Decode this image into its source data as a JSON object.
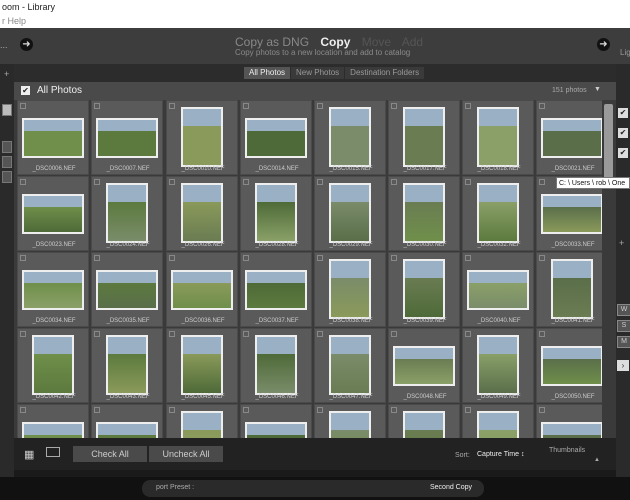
{
  "window": {
    "title": "oom - Library",
    "menu": "r Help"
  },
  "modebar": {
    "copy_dng": "Copy as DNG",
    "copy": "Copy",
    "move": "Move",
    "add": "Add",
    "subtitle": "Copy photos to a new location and add to catalog",
    "ellipsis": "...",
    "right_text": "Lig"
  },
  "source_tabs": [
    "All Photos",
    "New Photos",
    "Destination Folders"
  ],
  "header": {
    "title": "All Photos",
    "count": "151 photos"
  },
  "photos": [
    [
      "_DSC0006.NEF",
      "_DSC0007.NEF",
      "_DSC0010.NEF",
      "_DSC0014.NEF",
      "_DSC0015.NEF",
      "_DSC0017.NEF",
      "_DSC0018.NEF",
      "_DSC0021.NEF"
    ],
    [
      "_DSC0023.NEF",
      "_DSC0024.NEF",
      "_DSC0026.NEF",
      "_DSC0028.NEF",
      "_DSC0029.NEF",
      "_DSC0030.NEF",
      "_DSC0032.NEF",
      "_DSC0033.NEF"
    ],
    [
      "_DSC0034.NEF",
      "_DSC0035.NEF",
      "_DSC0036.NEF",
      "_DSC0037.NEF",
      "_DSC0038.NEF",
      "_DSC0039.NEF",
      "_DSC0040.NEF",
      "_DSC0041.NEF"
    ],
    [
      "_DSC0042.NEF",
      "_DSC0043.NEF",
      "_DSC0045.NEF",
      "_DSC0046.NEF",
      "_DSC0047.NEF",
      "_DSC0048.NEF",
      "_DSC0049.NEF",
      "_DSC0050.NEF"
    ]
  ],
  "tooltip": "C: \\ Users \\ rob \\ One",
  "right_panel_boxes": [
    "W",
    "S",
    "M"
  ],
  "toolbar": {
    "check_all": "Check All",
    "uncheck_all": "Uncheck All",
    "sort_label": "Sort:",
    "sort_value": "Capture Time ↕",
    "thumbnails_label": "Thumbnails"
  },
  "footer": {
    "preset_label": "port Preset :",
    "preset_value": "Second Copy"
  },
  "colors": {
    "bg": "#3a3a3a",
    "cell": "#5a5a5a",
    "accent": "#eeeeee"
  }
}
